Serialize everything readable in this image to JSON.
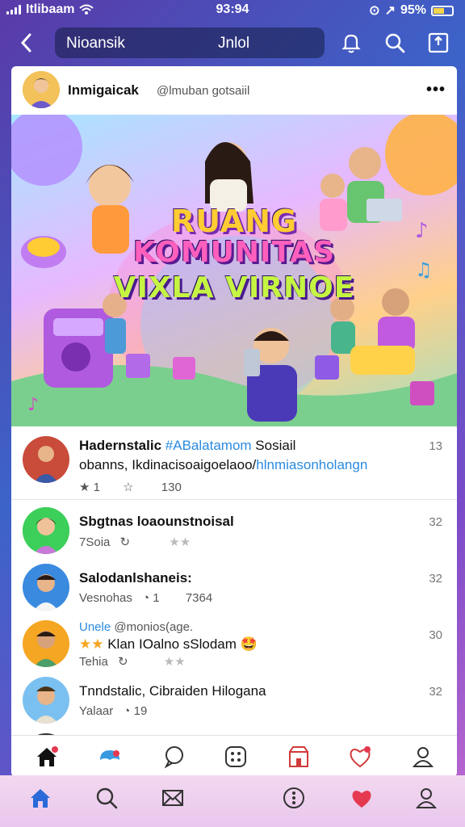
{
  "status": {
    "carrier": "Itlibaam",
    "time": "93:94",
    "battery": "95%"
  },
  "topbar": {
    "search_left": "Nioansik",
    "search_right": "Jnlol"
  },
  "post": {
    "author": "Inmigaicak",
    "handle": "@lmuban gotsaiil",
    "banner_line1": "RUANG",
    "banner_line2": "KOMUNITAS",
    "banner_line3": "VIXLA VIRNOE"
  },
  "comments": [
    {
      "line1_bold": "Hadernstalic",
      "line1_link": "#ABalatamom",
      "line1_rest": "Sosiail",
      "line2": "obanns, Ikdinacisoaigoelaoo/",
      "line2_link": "hlnmiasonholangn",
      "time": "13",
      "meta_count": "1",
      "meta_right": "130"
    },
    {
      "name": "Sbgtnas loaounstnoisal",
      "time": "32",
      "meta": "7Soia"
    },
    {
      "name": "Salodanlshaneis:",
      "time": "32",
      "meta": "Vesnohas",
      "meta_count": "1",
      "meta_right": "7364"
    },
    {
      "line1_link": "Unele",
      "line1_rest": "@monios(age.",
      "line2": "Klan IOalno sSlodam",
      "time": "30",
      "meta": "Tehia"
    },
    {
      "name": "Tnndstalic, Cibraiden Hilogana",
      "time": "32",
      "meta": "Yalaar",
      "meta_count": "19"
    }
  ],
  "icons": {
    "back": "back-arrow-icon",
    "bell": "bell-icon",
    "search": "search-icon",
    "share": "share-icon",
    "more": "more-dots-icon",
    "home": "home-icon",
    "explore": "explore-icon",
    "chat": "chat-icon",
    "apps": "apps-icon",
    "store": "store-icon",
    "heart": "heart-icon",
    "profile": "profile-icon",
    "mail": "mail-icon",
    "menu": "menu-dots-icon"
  },
  "colors": {
    "accent": "#2a8ae0",
    "heart": "#e53950",
    "brand": "#6a3fc2"
  }
}
